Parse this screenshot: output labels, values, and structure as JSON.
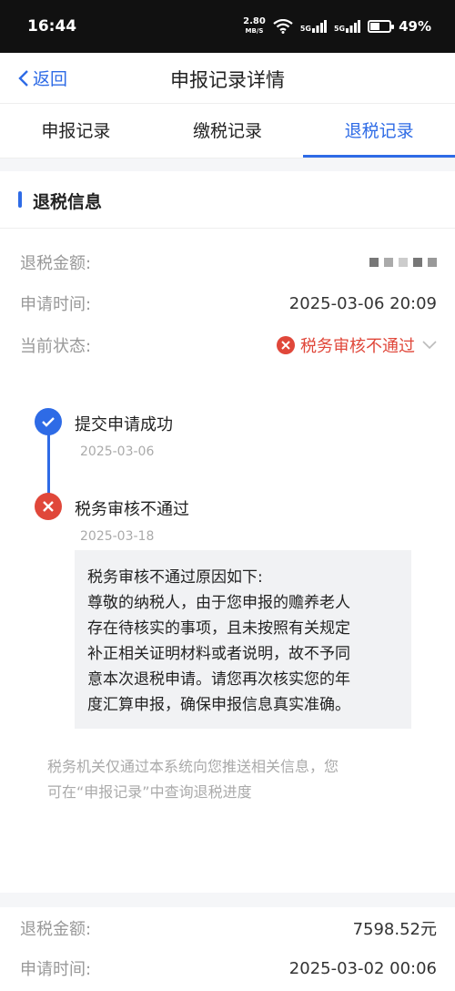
{
  "status_bar": {
    "time": "16:44",
    "net_speed_value": "2.80",
    "net_speed_unit": "MB/S",
    "signal1_label": "5G",
    "signal2_label": "5G",
    "battery": "49%"
  },
  "header": {
    "back_label": "返回",
    "title": "申报记录详情"
  },
  "tabs": [
    {
      "label": "申报记录",
      "active": false
    },
    {
      "label": "缴税记录",
      "active": false
    },
    {
      "label": "退税记录",
      "active": true
    }
  ],
  "refund_info": {
    "section_title": "退税信息",
    "amount_label": "退税金额:",
    "apply_time_label": "申请时间:",
    "apply_time": "2025-03-06 20:09",
    "status_label": "当前状态:",
    "status_value": "税务审核不通过"
  },
  "timeline": [
    {
      "title": "提交申请成功",
      "date": "2025-03-06",
      "state": "success"
    },
    {
      "title": "税务审核不通过",
      "date": "2025-03-18",
      "state": "failed"
    }
  ],
  "reason_box": {
    "line1": "税务审核不通过原因如下:",
    "line2": "尊敬的纳税人，由于您申报的赡养老人",
    "line3": "存在待核实的事项，且未按照有关规定",
    "line4": "补正相关证明材料或者说明，故不予同",
    "line5": "意本次退税申请。请您再次核实您的年",
    "line6": "度汇算申报，确保申报信息真实准确。"
  },
  "notice": {
    "line1": "税务机关仅通过本系统向您推送相关信息，您",
    "line2": "可在“申报记录”中查询退税进度"
  },
  "second_record": {
    "amount_label": "退税金额:",
    "amount_value": "7598.52元",
    "apply_time_label": "申请时间:",
    "apply_time": "2025-03-02 00:06"
  },
  "colors": {
    "accent": "#2e6be6",
    "error": "#e0473a"
  }
}
